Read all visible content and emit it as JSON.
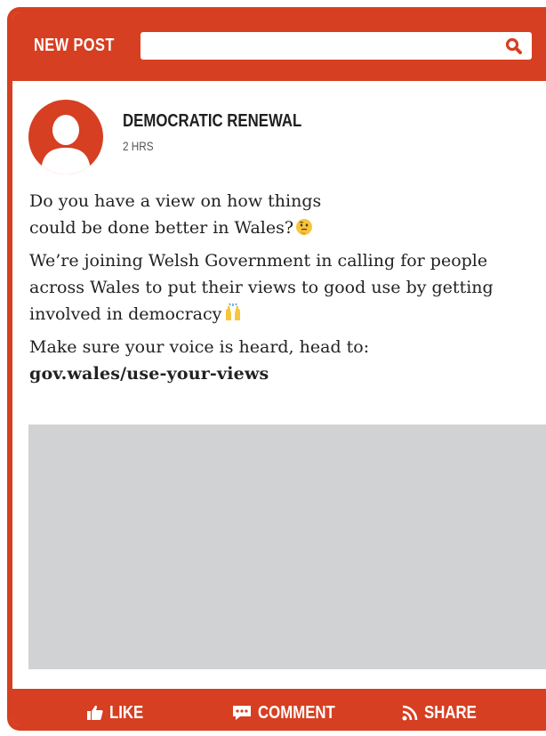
{
  "topbar": {
    "new_post_label": "NEW POST",
    "search": {
      "value": "",
      "icon": "search-icon"
    }
  },
  "post": {
    "author": "DEMOCRATIC RENEWAL",
    "time": "2 HRS",
    "avatar_icon": "user-silhouette-icon",
    "paragraphs": {
      "p1_line1": "Do you have a view on how things",
      "p1_line2": "could be done better in Wales?",
      "p1_emoji": "thinking-face-emoji",
      "p2": "We’re joining Welsh Government in calling for people across Wales to put their views to good use by getting involved in democracy",
      "p2_emoji": "raised-hands-emoji",
      "p3": "Make sure your voice is heard, head to:",
      "link": "gov.wales/use-your-views"
    }
  },
  "actions": {
    "like": "LIKE",
    "comment": "COMMENT",
    "share": "SHARE"
  },
  "colors": {
    "brand": "#d63f22",
    "media_placeholder": "#d1d2d4",
    "text": "#222222"
  }
}
